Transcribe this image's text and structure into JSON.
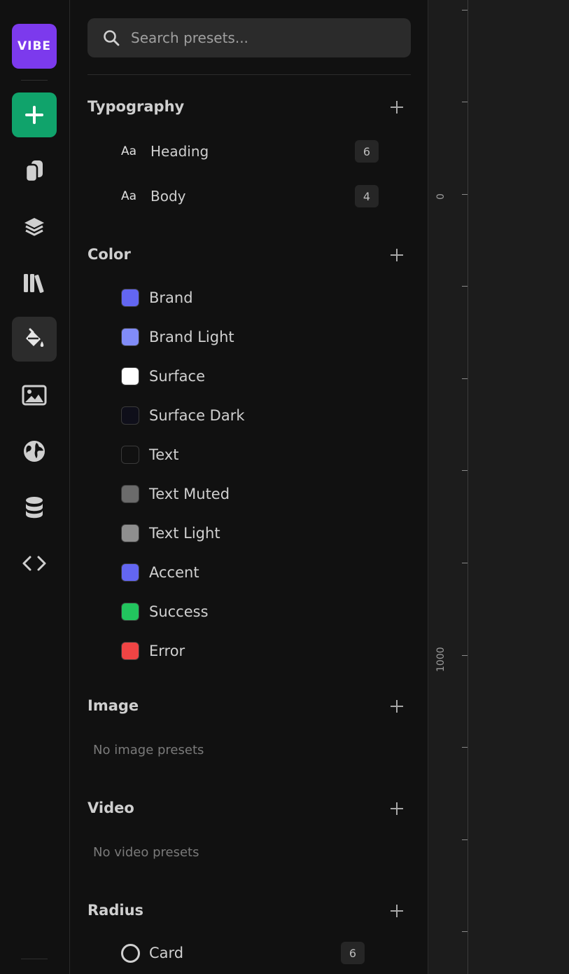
{
  "rail": {
    "logo": "VIBE",
    "items": [
      {
        "name": "add",
        "icon": "plus-icon"
      },
      {
        "name": "pages",
        "icon": "pages-icon"
      },
      {
        "name": "layers",
        "icon": "layers-icon"
      },
      {
        "name": "library",
        "icon": "library-icon"
      },
      {
        "name": "styles",
        "icon": "paint-bucket-icon",
        "active": true
      },
      {
        "name": "media",
        "icon": "image-icon"
      },
      {
        "name": "globe",
        "icon": "globe-icon"
      },
      {
        "name": "database",
        "icon": "database-icon"
      },
      {
        "name": "code",
        "icon": "code-icon"
      }
    ]
  },
  "search": {
    "placeholder": "Search presets..."
  },
  "sections": {
    "typography": {
      "title": "Typography",
      "items": [
        {
          "prefix": "Aa",
          "label": "Heading",
          "count": "6"
        },
        {
          "prefix": "Aa",
          "label": "Body",
          "count": "4"
        }
      ]
    },
    "color": {
      "title": "Color",
      "items": [
        {
          "label": "Brand",
          "color": "#6366f1"
        },
        {
          "label": "Brand Light",
          "color": "#818cf8"
        },
        {
          "label": "Surface",
          "color": "#ffffff"
        },
        {
          "label": "Surface Dark",
          "color": "#0f0f1a"
        },
        {
          "label": "Text",
          "color": "#111111"
        },
        {
          "label": "Text Muted",
          "color": "#6b6b6b"
        },
        {
          "label": "Text Light",
          "color": "#8e8e8e"
        },
        {
          "label": "Accent",
          "color": "#6366f1"
        },
        {
          "label": "Success",
          "color": "#22c55e"
        },
        {
          "label": "Error",
          "color": "#ef4444"
        }
      ]
    },
    "image": {
      "title": "Image",
      "empty": "No image presets"
    },
    "video": {
      "title": "Video",
      "empty": "No video presets"
    },
    "radius": {
      "title": "Radius",
      "items": [
        {
          "label": "Card",
          "count": "6"
        }
      ]
    }
  },
  "ruler": {
    "labels": [
      "0",
      "1000"
    ]
  }
}
